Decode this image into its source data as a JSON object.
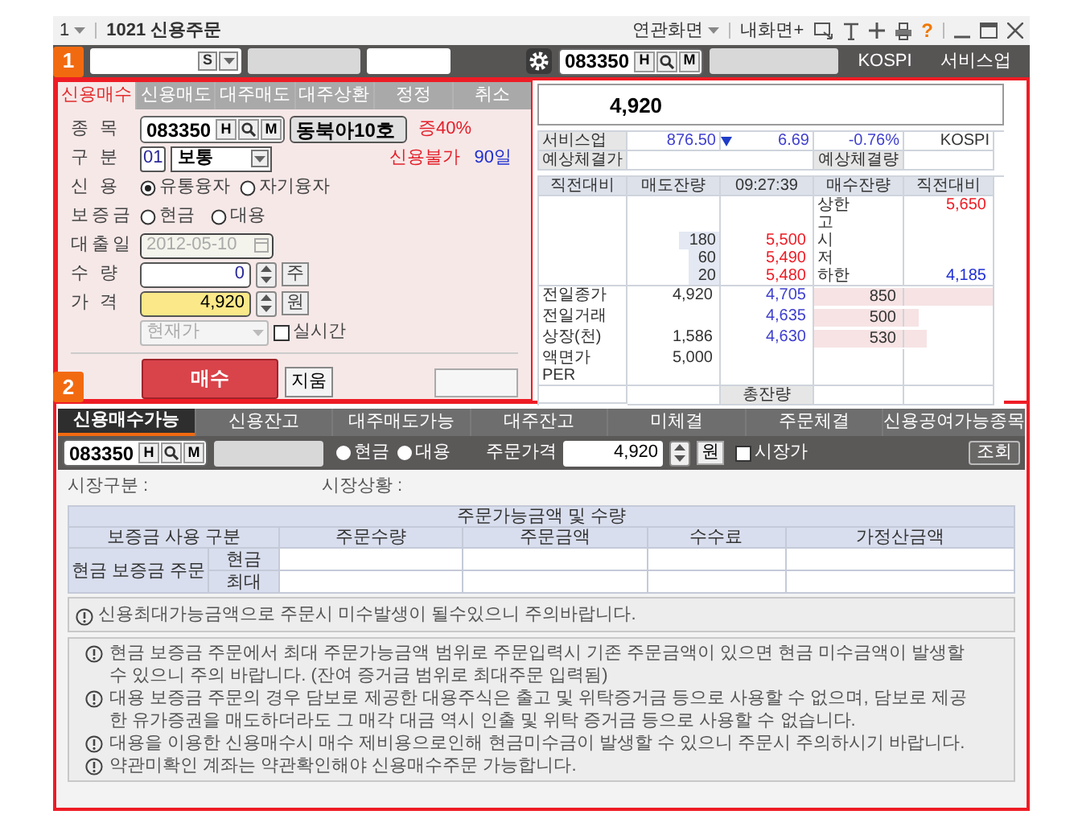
{
  "title_bar": {
    "menu": "1",
    "title": "1021 신용주문",
    "related_menu": "연관화면",
    "my_screen": "내화면+",
    "help": "?"
  },
  "toolbar": {
    "badge": "1",
    "account_button": "S",
    "stock_code": "083350",
    "history_button": "H",
    "memo_button": "M",
    "market": "KOSPI",
    "sector": "서비스업"
  },
  "order_form": {
    "badge": "2",
    "tabs": [
      {
        "label": "신용매수",
        "selected": true
      },
      {
        "label": "신용매도",
        "selected": false
      },
      {
        "label": "대주매도",
        "selected": false
      },
      {
        "label": "대주상환",
        "selected": false
      },
      {
        "label": "정정",
        "selected": false
      },
      {
        "label": "취소",
        "selected": false
      }
    ],
    "stock_label": "종 목",
    "stock_code": "083350",
    "history_button": "H",
    "memo_button": "M",
    "stock_name": "동북아10호",
    "margin_rate": "증40%",
    "type_label": "구 분",
    "type_code": "01",
    "type": "보통",
    "credit_status": "신용불가",
    "credit_days": "90일",
    "credit_label": "신 용",
    "credit_options": [
      {
        "label": "유통융자",
        "selected": true
      },
      {
        "label": "자기융자",
        "selected": false
      }
    ],
    "deposit_label": "보증금",
    "deposit_options": [
      {
        "label": "현금",
        "selected": false
      },
      {
        "label": "대용",
        "selected": false
      }
    ],
    "loan_date_label": "대출일",
    "loan_date": "2012-05-10",
    "quantity_label": "수 량",
    "quantity": "0",
    "quantity_unit": "주",
    "price_label": "가 격",
    "price": "4,920",
    "price_unit": "원",
    "price_type": "현재가",
    "realtime": {
      "label": "실시간",
      "checked": false
    },
    "buy_button": "매수",
    "clear_button": "지움"
  },
  "quote": {
    "current_price": "4,920",
    "sector": "서비스업",
    "index": "876.50",
    "falling": true,
    "change": "6.69",
    "change_rate": "-0.76%",
    "market": "KOSPI",
    "expected_price_label": "예상체결가",
    "expected_volume_label": "예상체결량",
    "columns": [
      "직전대비",
      "매도잔량",
      "09:27:39",
      "매수잔량",
      "직전대비"
    ],
    "ask_rows": [
      {
        "label": "상한",
        "value": "5,650",
        "color": "#ee1c25"
      },
      {
        "label": "고"
      },
      {
        "qty": "180",
        "price": "5,500",
        "label": "시"
      },
      {
        "qty": "60",
        "price": "5,490",
        "label": "저"
      },
      {
        "qty": "20",
        "price": "5,480",
        "label": "하한",
        "value": "4,185",
        "color": "#1f2fd8"
      }
    ],
    "bid_rows": [
      {
        "label": "전일종가",
        "value": "4,920",
        "price": "4,705",
        "qty": "850",
        "level": 1
      },
      {
        "label": "전일거래",
        "price": "4,635",
        "qty": "500",
        "level": 0.17
      },
      {
        "label": "상장(천)",
        "value": "1,586",
        "price": "4,630",
        "qty": "530",
        "level": 0.25
      },
      {
        "label": "액면가",
        "value": "5,000"
      },
      {
        "label": "PER"
      }
    ],
    "total_label": "총잔량"
  },
  "lower_panel": {
    "tabs": [
      {
        "label": "신용매수가능",
        "selected": true
      },
      {
        "label": "신용잔고",
        "selected": false
      },
      {
        "label": "대주매도가능",
        "selected": false
      },
      {
        "label": "대주잔고",
        "selected": false
      },
      {
        "label": "미체결",
        "selected": false
      },
      {
        "label": "주문체결",
        "selected": false
      },
      {
        "label": "신용공여가능종목",
        "selected": false
      }
    ],
    "stock_code": "083350",
    "history_button": "H",
    "memo_button": "M",
    "deposit_options": [
      {
        "label": "현금",
        "selected": true
      },
      {
        "label": "대용",
        "selected": true
      }
    ],
    "order_price_label": "주문가격",
    "order_price": "4,920",
    "price_unit": "원",
    "market_order": {
      "label": "시장가",
      "checked": false
    },
    "query_button": "조회",
    "market_type_label": "시장구분 :",
    "market_status_label": "시장상황 :",
    "table": {
      "title": "주문가능금액 및 수량",
      "columns": [
        "보증금 사용 구분",
        "주문수량",
        "주문금액",
        "수수료",
        "가정산금액"
      ],
      "group_label": "현금 보증금 주문",
      "rows": [
        "현금",
        "최대"
      ]
    },
    "warning": "신용최대가능금액으로 주문시 미수발생이 될수있으니 주의바랍니다.",
    "notes": [
      "현금 보증금 주문에서 최대 주문가능금액 범위로 주문입력시 기존 주문금액이 있으면 현금 미수금액이 발생할 수 있으니 주의 바랍니다. (잔여 증거금 범위로 최대주문 입력됨)",
      "대용 보증금 주문의 경우 담보로 제공한 대용주식은 출고 및 위탁증거금 등으로 사용할 수 없으며, 담보로 제공한 유가증권을 매도하더라도 그 매각 대금 역시 인출 및 위탁 증거금 등으로 사용할 수 없습니다.",
      "대용을 이용한 신용매수시 매수 제비용으로인해 현금미수금이 발생할 수 있으니 주문시 주의하시기 바랍니다.",
      "약관미확인 계좌는 약관확인해야 신용매수주문 가능합니다."
    ]
  }
}
